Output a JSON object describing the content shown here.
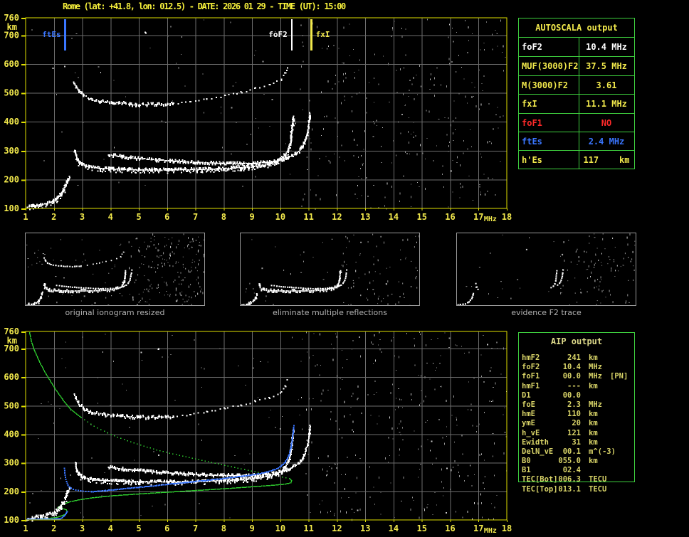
{
  "title": "Rome (lat: +41.8, lon: 012.5) - DATE: 2026 01 29 - TIME (UT): 15:00",
  "colors": {
    "white": "#ffffff",
    "yellow": "#f2e94c",
    "border_yellow": "#dfdf00",
    "blue": "#3a76ff",
    "red": "#ff2a2a",
    "green": "#2ecc2e",
    "grid": "#6e6e6e",
    "noise": "#969696",
    "caption": "#b2b2b2",
    "aip_text": "#d9d468"
  },
  "autoscala": {
    "title": "AUTOSCALA output",
    "rows": [
      {
        "label": "foF2",
        "value": "10.4 MHz",
        "color": "#ffffff"
      },
      {
        "label": "MUF(3000)F2",
        "value": "37.5 MHz",
        "color": "#f2e94c"
      },
      {
        "label": "M(3000)F2",
        "value": "3.61",
        "color": "#f2e94c"
      },
      {
        "label": "fxI",
        "value": "11.1 MHz",
        "color": "#f2e94c"
      },
      {
        "label": "foF1",
        "value": "NO",
        "color": "#ff2a2a"
      },
      {
        "label": "ftEs",
        "value": "2.4 MHz",
        "color": "#3a76ff"
      },
      {
        "label": "h'Es",
        "value": "117    km",
        "color": "#f2e94c"
      }
    ]
  },
  "aip": {
    "title": "AIP output",
    "rows": [
      {
        "label": "hmF2",
        "value": "241",
        "unit": "km",
        "extra": ""
      },
      {
        "label": "foF2",
        "value": "10.4",
        "unit": "MHz",
        "extra": ""
      },
      {
        "label": "foF1",
        "value": "00.0",
        "unit": "MHz",
        "extra": "[PN]"
      },
      {
        "label": "hmF1",
        "value": "---",
        "unit": "km",
        "extra": ""
      },
      {
        "label": "D1",
        "value": "00.0",
        "unit": "",
        "extra": ""
      },
      {
        "label": "foE",
        "value": "2.3",
        "unit": "MHz",
        "extra": ""
      },
      {
        "label": "hmE",
        "value": "110",
        "unit": "km",
        "extra": ""
      },
      {
        "label": "ymE",
        "value": "20",
        "unit": "km",
        "extra": ""
      },
      {
        "label": "h_vE",
        "value": "121",
        "unit": "km",
        "extra": ""
      },
      {
        "label": "Ewidth",
        "value": "31",
        "unit": "km",
        "extra": ""
      },
      {
        "label": "DelN_vE",
        "value": "00.1",
        "unit": "m^(-3)",
        "extra": ""
      },
      {
        "label": "B0",
        "value": "055.0",
        "unit": "km",
        "extra": ""
      },
      {
        "label": "B1",
        "value": "02.4",
        "unit": "",
        "extra": ""
      },
      {
        "label": "TEC[Bot]",
        "value": "006.3",
        "unit": "TECU",
        "extra": ""
      },
      {
        "label": "TEC[Top]",
        "value": "013.1",
        "unit": "TECU",
        "extra": ""
      }
    ]
  },
  "thumbnails": [
    {
      "caption": "original ionogram resized"
    },
    {
      "caption": "eliminate multiple reflections"
    },
    {
      "caption": "evidence F2 trace"
    }
  ],
  "chart_data": {
    "type": "scatter",
    "x_unit": "MHz",
    "y_unit": "km",
    "xlim": [
      1,
      18
    ],
    "ylim": [
      100,
      760
    ],
    "xticks": [
      1,
      2,
      3,
      4,
      5,
      6,
      7,
      8,
      9,
      10,
      11,
      12,
      13,
      14,
      15,
      16,
      17,
      18
    ],
    "yticks": [
      760,
      700,
      600,
      500,
      400,
      300,
      200,
      100
    ],
    "scaled_values": {
      "foF2_MHz": 10.4,
      "fxI_MHz": 11.1,
      "ftEs_MHz": 2.4,
      "foF1": "NO",
      "hmF2_km": 241,
      "hEs_km": 117
    },
    "markers": [
      {
        "label": "ftEs",
        "f": 2.4,
        "color": "blue",
        "side": "left",
        "lw": 3
      },
      {
        "label": "foF2",
        "f": 10.4,
        "color": "white",
        "side": "left",
        "lw": 2
      },
      {
        "label": "fxI",
        "f": 11.1,
        "color": "yellow",
        "side": "right",
        "lw": 3
      }
    ],
    "traces": {
      "hop2a": [
        [
          2.7,
          538
        ],
        [
          2.85,
          512
        ],
        [
          3.05,
          492
        ],
        [
          3.35,
          478
        ],
        [
          3.8,
          470
        ],
        [
          4.3,
          466
        ],
        [
          4.9,
          462
        ],
        [
          5.6,
          461
        ],
        [
          6.2,
          464
        ]
      ],
      "hop2b": [
        [
          6.2,
          464
        ],
        [
          6.8,
          472
        ],
        [
          7.4,
          481
        ],
        [
          8.0,
          492
        ],
        [
          8.6,
          505
        ],
        [
          9.1,
          517
        ],
        [
          9.6,
          530
        ],
        [
          10.0,
          548
        ],
        [
          10.15,
          572
        ],
        [
          10.25,
          592
        ]
      ],
      "omode": [
        [
          2.72,
          302
        ],
        [
          2.8,
          272
        ],
        [
          2.95,
          254
        ],
        [
          3.2,
          246
        ],
        [
          3.6,
          241
        ],
        [
          4.2,
          238
        ],
        [
          5.0,
          236
        ],
        [
          6.0,
          236
        ],
        [
          7.0,
          237
        ],
        [
          8.0,
          240
        ],
        [
          8.7,
          244
        ],
        [
          9.2,
          249
        ],
        [
          9.6,
          256
        ],
        [
          9.9,
          266
        ],
        [
          10.1,
          280
        ],
        [
          10.25,
          302
        ],
        [
          10.33,
          330
        ],
        [
          10.38,
          365
        ],
        [
          10.42,
          400
        ],
        [
          10.44,
          422
        ]
      ],
      "xmode": [
        [
          3.9,
          288
        ],
        [
          4.4,
          281
        ],
        [
          5.0,
          275
        ],
        [
          5.6,
          270
        ],
        [
          6.2,
          266
        ],
        [
          6.9,
          262
        ],
        [
          7.6,
          259
        ],
        [
          8.3,
          258
        ],
        [
          9.0,
          258
        ],
        [
          9.5,
          261
        ],
        [
          9.9,
          267
        ],
        [
          10.2,
          276
        ],
        [
          10.5,
          290
        ],
        [
          10.7,
          308
        ],
        [
          10.85,
          335
        ],
        [
          10.95,
          370
        ],
        [
          11.0,
          400
        ],
        [
          11.03,
          428
        ]
      ],
      "es": [
        [
          1.05,
          107
        ],
        [
          1.25,
          110
        ],
        [
          1.5,
          114
        ],
        [
          1.75,
          119
        ],
        [
          1.95,
          127
        ],
        [
          2.1,
          137
        ],
        [
          2.22,
          150
        ],
        [
          2.32,
          165
        ],
        [
          2.4,
          182
        ],
        [
          2.47,
          200
        ],
        [
          2.52,
          210
        ]
      ],
      "stray": [
        [
          5.2,
          712
        ],
        [
          5.22,
          710
        ]
      ],
      "stray2": [
        [
          5.66,
          700
        ],
        [
          5.68,
          702
        ]
      ],
      "green1": [
        [
          1.12,
          758
        ],
        [
          1.2,
          722
        ],
        [
          1.32,
          690
        ],
        [
          1.5,
          650
        ],
        [
          1.72,
          610
        ],
        [
          2.0,
          565
        ],
        [
          2.3,
          522
        ],
        [
          2.6,
          487
        ],
        [
          2.95,
          460
        ]
      ],
      "green2": [
        [
          2.95,
          460
        ],
        [
          3.4,
          430
        ],
        [
          4.0,
          400
        ],
        [
          4.7,
          375
        ],
        [
          5.5,
          350
        ],
        [
          6.3,
          330
        ],
        [
          7.1,
          313
        ],
        [
          7.9,
          295
        ],
        [
          8.6,
          280
        ],
        [
          9.2,
          268
        ],
        [
          9.7,
          259
        ],
        [
          10.05,
          252
        ],
        [
          10.3,
          247
        ]
      ],
      "green3": [
        [
          10.3,
          247
        ],
        [
          10.38,
          240
        ],
        [
          10.35,
          232
        ],
        [
          10.15,
          227
        ],
        [
          9.7,
          223
        ],
        [
          9.0,
          218
        ],
        [
          8.0,
          211
        ],
        [
          7.0,
          205
        ],
        [
          6.0,
          199
        ],
        [
          5.0,
          193
        ],
        [
          4.0,
          186
        ],
        [
          3.3,
          179
        ],
        [
          2.85,
          172
        ],
        [
          2.5,
          164
        ],
        [
          2.3,
          157
        ],
        [
          2.18,
          150
        ],
        [
          2.12,
          145
        ]
      ],
      "green4": [
        [
          2.12,
          145
        ],
        [
          2.3,
          142
        ],
        [
          2.42,
          137
        ],
        [
          2.45,
          130
        ],
        [
          2.38,
          122
        ],
        [
          2.25,
          116
        ],
        [
          2.1,
          111
        ],
        [
          1.85,
          108
        ],
        [
          1.6,
          106
        ],
        [
          1.35,
          104
        ],
        [
          1.1,
          103
        ]
      ],
      "blue_es": [
        [
          1.02,
          104
        ],
        [
          1.7,
          105
        ],
        [
          2.2,
          106
        ],
        [
          2.28,
          111
        ],
        [
          2.38,
          121
        ],
        [
          2.44,
          132
        ]
      ],
      "blue_vert": [
        [
          2.35,
          283
        ],
        [
          2.36,
          268
        ],
        [
          2.38,
          252
        ],
        [
          2.42,
          237
        ],
        [
          2.48,
          224
        ],
        [
          2.58,
          214
        ],
        [
          2.75,
          207
        ],
        [
          3.0,
          203
        ],
        [
          3.3,
          201
        ]
      ],
      "blue_main": [
        [
          3.3,
          201
        ],
        [
          3.8,
          205
        ],
        [
          4.4,
          211
        ],
        [
          5.0,
          217
        ],
        [
          5.6,
          223
        ],
        [
          6.2,
          229
        ],
        [
          6.8,
          235
        ],
        [
          7.4,
          241
        ],
        [
          8.0,
          248
        ],
        [
          8.6,
          255
        ],
        [
          9.1,
          262
        ],
        [
          9.5,
          270
        ],
        [
          9.8,
          279
        ],
        [
          10.0,
          290
        ],
        [
          10.15,
          305
        ],
        [
          10.27,
          327
        ],
        [
          10.35,
          355
        ],
        [
          10.4,
          385
        ],
        [
          10.44,
          415
        ],
        [
          10.46,
          432
        ]
      ]
    },
    "plots": [
      {
        "svg": "plot-top",
        "markers": true,
        "noise": {
          "seed": 7,
          "base": 130,
          "right": 240
        },
        "series": [
          {
            "ref": "hop2a",
            "color": "white",
            "step": 2.5,
            "size": 2,
            "thick": 2,
            "jitter": 2
          },
          {
            "ref": "hop2b",
            "color": "white",
            "step": 6,
            "size": 2,
            "thick": 1,
            "jitter": 2.5
          },
          {
            "ref": "xmode",
            "color": "white",
            "step": 2,
            "size": 2,
            "thick": 2,
            "jitter": 1
          },
          {
            "ref": "omode",
            "color": "white",
            "step": 2,
            "size": 2,
            "thick": 3,
            "jitter": 1
          },
          {
            "ref": "es",
            "color": "white",
            "step": 2,
            "size": 2,
            "thick": 3,
            "jitter": 1.5
          },
          {
            "ref": "stray",
            "color": "white",
            "step": 2,
            "size": 2,
            "thick": 1,
            "jitter": 0
          }
        ]
      },
      {
        "svg": "plot-bottom",
        "markers": false,
        "noise": {
          "seed": 13,
          "base": 150,
          "right": 250
        },
        "series": [
          {
            "ref": "green1",
            "color": "green",
            "step": 1.6,
            "size": 1.5,
            "thick": 1,
            "jitter": 0
          },
          {
            "ref": "green2",
            "color": "green",
            "step": 5,
            "size": 1.5,
            "thick": 1,
            "jitter": 0
          },
          {
            "ref": "green3",
            "color": "green",
            "step": 1.6,
            "size": 1.5,
            "thick": 1,
            "jitter": 0
          },
          {
            "ref": "green4",
            "color": "green",
            "step": 1.6,
            "size": 1.5,
            "thick": 1,
            "jitter": 0
          },
          {
            "ref": "hop2a",
            "color": "white",
            "step": 2.5,
            "size": 2,
            "thick": 2,
            "jitter": 2
          },
          {
            "ref": "hop2b",
            "color": "white",
            "step": 6,
            "size": 2,
            "thick": 1,
            "jitter": 2.5
          },
          {
            "ref": "xmode",
            "color": "white",
            "step": 2,
            "size": 2,
            "thick": 2,
            "jitter": 1
          },
          {
            "ref": "omode",
            "color": "white",
            "step": 2,
            "size": 2,
            "thick": 3,
            "jitter": 1
          },
          {
            "ref": "es",
            "color": "white",
            "step": 2,
            "size": 2,
            "thick": 3,
            "jitter": 1.5
          },
          {
            "ref": "stray2",
            "color": "white",
            "step": 2,
            "size": 2,
            "thick": 1,
            "jitter": 0
          },
          {
            "ref": "blue_es",
            "color": "blue",
            "step": 2,
            "size": 2,
            "thick": 1,
            "jitter": 0.5
          },
          {
            "ref": "blue_vert",
            "color": "blue",
            "step": 3.5,
            "size": 2,
            "thick": 1,
            "jitter": 0.5
          },
          {
            "ref": "blue_main",
            "color": "blue",
            "step": 2.2,
            "size": 2,
            "thick": 1,
            "jitter": 0.5
          }
        ]
      }
    ],
    "thumbs": [
      {
        "svg": "thumb-0",
        "noise": {
          "seed": 3,
          "base": 80,
          "right": 170
        },
        "series": [
          {
            "ref": "hop2a",
            "color": "white",
            "step": 3,
            "size": 2,
            "thick": 1,
            "jitter": 1
          },
          {
            "ref": "hop2b",
            "color": "white",
            "step": 6,
            "size": 1.5,
            "thick": 1,
            "jitter": 1
          },
          {
            "ref": "xmode",
            "color": "white",
            "step": 3,
            "size": 2,
            "thick": 1,
            "jitter": 0.5
          },
          {
            "ref": "omode",
            "color": "white",
            "step": 2.5,
            "size": 2,
            "thick": 2,
            "jitter": 0.5
          },
          {
            "ref": "es",
            "color": "white",
            "step": 2.5,
            "size": 2,
            "thick": 2,
            "jitter": 1
          }
        ]
      },
      {
        "svg": "thumb-1",
        "noise": {
          "seed": 4,
          "base": 55,
          "right": 55
        },
        "series": [
          {
            "ref": "xmode",
            "color": "white",
            "step": 3,
            "size": 2,
            "thick": 1,
            "jitter": 0.5
          },
          {
            "ref": "omode",
            "color": "white",
            "step": 2.5,
            "size": 2,
            "thick": 2,
            "jitter": 0.5
          },
          {
            "ref": "es",
            "color": "white",
            "step": 2.5,
            "size": 2,
            "thick": 2,
            "jitter": 1
          }
        ]
      },
      {
        "svg": "thumb-2",
        "noise": {
          "seed": 5,
          "base": 35,
          "right": 90
        },
        "series": [
          {
            "ref": "es",
            "color": "white",
            "step": 3,
            "size": 2,
            "thick": 1,
            "jitter": 1
          },
          {
            "ref": "omode",
            "fmax": 3.1,
            "color": "white",
            "step": 4,
            "size": 2,
            "thick": 1,
            "jitter": 1
          },
          {
            "ref": "omode",
            "fmin": 9.7,
            "color": "white",
            "step": 3,
            "size": 2,
            "thick": 1,
            "jitter": 0.5
          },
          {
            "ref": "xmode",
            "fmin": 10.4,
            "color": "white",
            "step": 3,
            "size": 2,
            "thick": 1,
            "jitter": 0.5
          }
        ]
      }
    ]
  }
}
